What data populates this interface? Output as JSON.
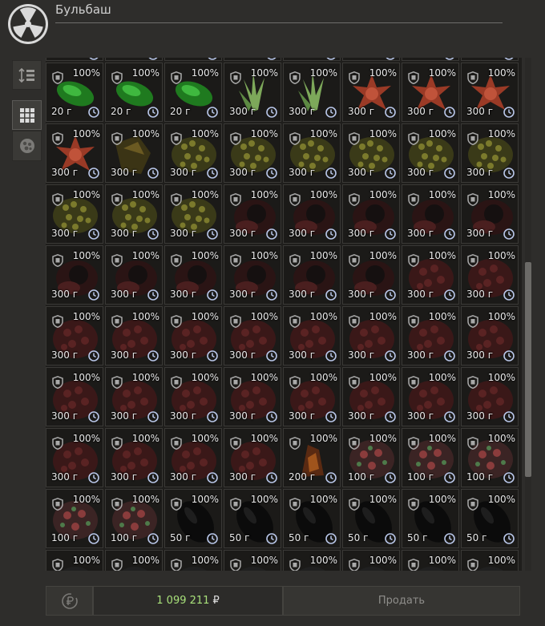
{
  "window": {
    "title": "Бульбаш"
  },
  "toolbar": {
    "items": [
      {
        "name": "sort-button",
        "icon": "sort-icon"
      },
      {
        "name": "grid-view-button",
        "icon": "grid-icon"
      },
      {
        "name": "artifact-filter-button",
        "icon": "artifact-icon"
      }
    ]
  },
  "grid": {
    "rows": [
      {
        "kind": "partial-top",
        "cells": [
          "green",
          "green",
          "green",
          "dark",
          "grey",
          "grey",
          "grey",
          "grey"
        ]
      },
      {
        "pct": [
          "100%",
          "100%",
          "100%",
          "100%",
          "100%",
          "100%",
          "100%",
          "100%"
        ],
        "wt": [
          "20 г",
          "20 г",
          "20 г",
          "300 г",
          "300 г",
          "300 г",
          "300 г",
          "300 г"
        ],
        "art": [
          "green",
          "green",
          "green",
          "plant",
          "plant",
          "redstar",
          "redstar",
          "redstar"
        ]
      },
      {
        "pct": [
          "100%",
          "100%",
          "100%",
          "100%",
          "100%",
          "100%",
          "100%",
          "100%"
        ],
        "wt": [
          "300 г",
          "300 г",
          "300 г",
          "300 г",
          "300 г",
          "300 г",
          "300 г",
          "300 г"
        ],
        "art": [
          "redstar",
          "brown",
          "olive",
          "olive",
          "olive",
          "olive",
          "olive",
          "olive"
        ]
      },
      {
        "pct": [
          "100%",
          "100%",
          "100%",
          "100%",
          "100%",
          "100%",
          "100%",
          "100%"
        ],
        "wt": [
          "300 г",
          "300 г",
          "300 г",
          "300 г",
          "300 г",
          "300 г",
          "300 г",
          "300 г"
        ],
        "art": [
          "olive",
          "olive",
          "olive",
          "darkred",
          "darkred",
          "darkred",
          "darkred",
          "darkred"
        ]
      },
      {
        "pct": [
          "100%",
          "100%",
          "100%",
          "100%",
          "100%",
          "100%",
          "100%",
          "100%"
        ],
        "wt": [
          "300 г",
          "300 г",
          "300 г",
          "300 г",
          "300 г",
          "300 г",
          "300 г",
          "300 г"
        ],
        "art": [
          "darkred",
          "darkred",
          "darkred",
          "darkred",
          "darkred",
          "darkred",
          "maroon",
          "maroon"
        ]
      },
      {
        "pct": [
          "100%",
          "100%",
          "100%",
          "100%",
          "100%",
          "100%",
          "100%",
          "100%"
        ],
        "wt": [
          "300 г",
          "300 г",
          "300 г",
          "300 г",
          "300 г",
          "300 г",
          "300 г",
          "300 г"
        ],
        "art": [
          "maroon",
          "maroon",
          "maroon",
          "maroon",
          "maroon",
          "maroon",
          "maroon",
          "maroon"
        ]
      },
      {
        "pct": [
          "100%",
          "100%",
          "100%",
          "100%",
          "100%",
          "100%",
          "100%",
          "100%"
        ],
        "wt": [
          "300 г",
          "300 г",
          "300 г",
          "300 г",
          "300 г",
          "300 г",
          "300 г",
          "300 г"
        ],
        "art": [
          "maroon",
          "maroon",
          "maroon",
          "maroon",
          "maroon",
          "maroon",
          "maroon",
          "maroon"
        ]
      },
      {
        "pct": [
          "100%",
          "100%",
          "100%",
          "100%",
          "100%",
          "100%",
          "100%",
          "100%"
        ],
        "wt": [
          "300 г",
          "300 г",
          "300 г",
          "300 г",
          "200 г",
          "100 г",
          "100 г",
          "100 г"
        ],
        "art": [
          "maroon",
          "maroon",
          "maroon",
          "maroon",
          "amber",
          "flower",
          "flower",
          "flower"
        ]
      },
      {
        "pct": [
          "100%",
          "100%",
          "100%",
          "100%",
          "100%",
          "100%",
          "100%",
          "100%"
        ],
        "wt": [
          "100 г",
          "100 г",
          "50 г",
          "50 г",
          "50 г",
          "50 г",
          "50 г",
          "50 г"
        ],
        "art": [
          "flower",
          "flower",
          "black",
          "black",
          "black",
          "black",
          "black",
          "black"
        ]
      },
      {
        "kind": "partial-bottom",
        "pct": [
          "100%",
          "100%",
          "100%",
          "100%",
          "100%",
          "100%",
          "100%",
          "100%"
        ]
      }
    ]
  },
  "footer": {
    "balance": "1 099 211",
    "currency": "₽",
    "sell_label": "Продать"
  },
  "colors": {
    "accent_green": "#a8e07a",
    "background": "#2e2d2b"
  }
}
